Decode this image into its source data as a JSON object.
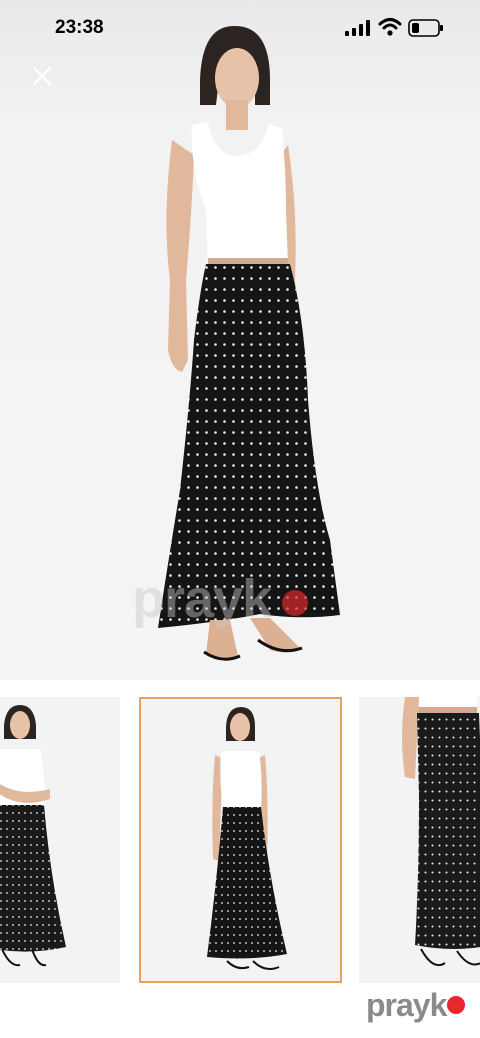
{
  "status": {
    "time": "23:38",
    "signal_icon": "signal-bars-icon",
    "wifi_icon": "wifi-icon",
    "battery_icon": "battery-low-icon"
  },
  "viewer": {
    "close_icon": "close-icon",
    "watermark_text": "prayk"
  },
  "thumbnails": {
    "items": [
      {
        "name": "thumbnail-1",
        "selected": false
      },
      {
        "name": "thumbnail-2",
        "selected": true
      },
      {
        "name": "thumbnail-3",
        "selected": false
      }
    ],
    "selected_border_color": "#e8a25b"
  },
  "footer": {
    "brand_text": "prayk",
    "brand_dot_color": "#e8262c"
  }
}
